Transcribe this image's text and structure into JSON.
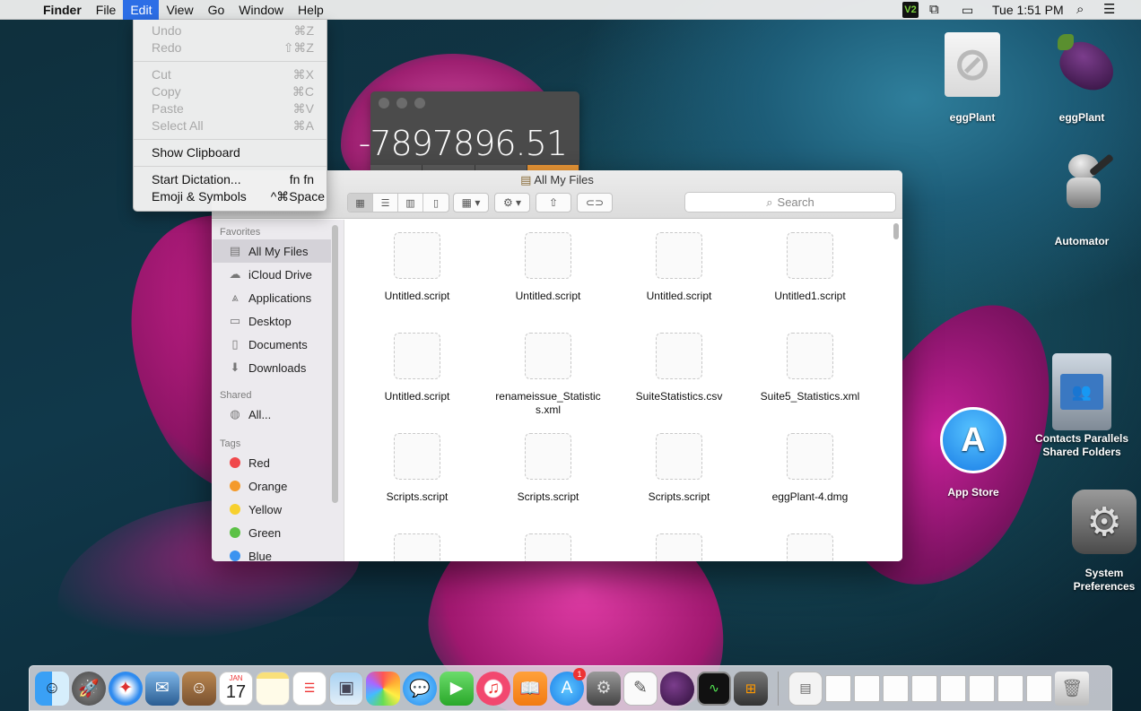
{
  "menubar": {
    "app": "Finder",
    "menus": [
      "File",
      "Edit",
      "View",
      "Go",
      "Window",
      "Help"
    ],
    "clock": "Tue 1:51 PM",
    "vnc_label": "V2"
  },
  "edit_menu": {
    "undo": {
      "label": "Undo",
      "shortcut": "⌘Z"
    },
    "redo": {
      "label": "Redo",
      "shortcut": "⇧⌘Z"
    },
    "cut": {
      "label": "Cut",
      "shortcut": "⌘X"
    },
    "copy": {
      "label": "Copy",
      "shortcut": "⌘C"
    },
    "paste": {
      "label": "Paste",
      "shortcut": "⌘V"
    },
    "select_all": {
      "label": "Select All",
      "shortcut": "⌘A"
    },
    "show_clipboard": {
      "label": "Show Clipboard"
    },
    "dictation": {
      "label": "Start Dictation...",
      "shortcut": "fn fn"
    },
    "emoji": {
      "label": "Emoji & Symbols",
      "shortcut": "^⌘Space"
    }
  },
  "calculator": {
    "display": "-7897896.51"
  },
  "finder": {
    "title": "All My Files",
    "search_placeholder": "Search",
    "sidebar": {
      "favorites_header": "Favorites",
      "favorites": [
        "All My Files",
        "iCloud Drive",
        "Applications",
        "Desktop",
        "Documents",
        "Downloads"
      ],
      "shared_header": "Shared",
      "shared": [
        "All..."
      ],
      "tags_header": "Tags",
      "tags": [
        "Red",
        "Orange",
        "Yellow",
        "Green",
        "Blue"
      ],
      "tag_colors": [
        "#f0484b",
        "#f49a2a",
        "#f7d02e",
        "#5cc146",
        "#3b93f0"
      ]
    },
    "files": [
      "Untitled.script",
      "Untitled.script",
      "Untitled.script",
      "Untitled1.script",
      "Untitled.script",
      "renameissue_Statistics.xml",
      "SuiteStatistics.csv",
      "Suite5_Statistics.xml",
      "Scripts.script",
      "Scripts.script",
      "Scripts.script",
      "eggPlant-4.dmg",
      "",
      "",
      "",
      ""
    ]
  },
  "desktop": {
    "icons": [
      "eggPlant",
      "eggPlant",
      "Automator",
      "Contacts Parallels Shared Folders",
      "App Store",
      "System Preferences"
    ]
  },
  "dock": {
    "calendar_month": "JAN",
    "calendar_day": "17",
    "appstore_badge": "1"
  }
}
